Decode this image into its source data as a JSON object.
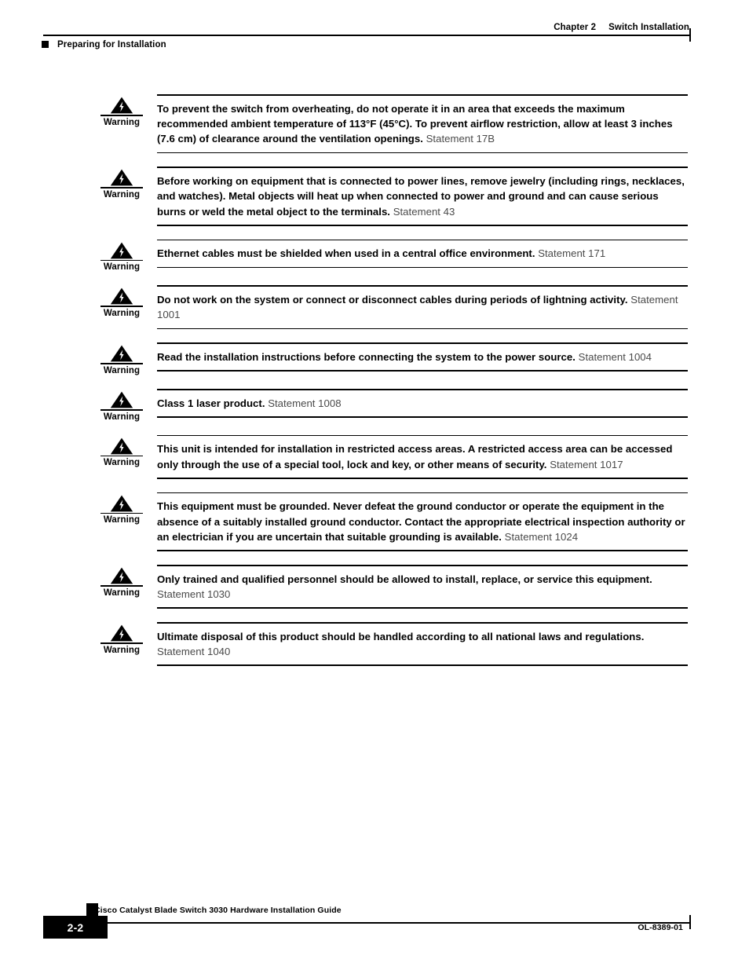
{
  "header": {
    "chapter_label": "Chapter 2",
    "chapter_title": "Switch Installation",
    "section_title": "Preparing for Installation"
  },
  "warning_label": "Warning",
  "icon_name": "warning-lightning-triangle-icon",
  "warnings": [
    {
      "text": "To prevent the switch from overheating, do not operate it in an area that exceeds the maximum recommended ambient temperature of 113°F (45°C). To prevent airflow restriction, allow at least 3 inches (7.6 cm) of clearance around the ventilation openings.",
      "statement": "Statement 17B"
    },
    {
      "text": "Before working on equipment that is connected to power lines, remove jewelry (including rings, necklaces, and watches). Metal objects will heat up when connected to power and ground and can cause serious burns or weld the metal object to the terminals.",
      "statement": "Statement 43"
    },
    {
      "text": "Ethernet cables must be shielded when used in a central office environment.",
      "statement": "Statement 171"
    },
    {
      "text": "Do not work on the system or connect or disconnect cables during periods of lightning activity.",
      "statement": "Statement 1001"
    },
    {
      "text": "Read the installation instructions before connecting the system to the power source.",
      "statement": "Statement 1004"
    },
    {
      "text": "Class 1 laser product.",
      "statement": "Statement 1008"
    },
    {
      "text": "This unit is intended for installation in restricted access areas. A restricted access area can be accessed only through the use of a special tool, lock and key, or other means of security.",
      "statement": "Statement 1017"
    },
    {
      "text": "This equipment must be grounded. Never defeat the ground conductor or operate the equipment in the absence of a suitably installed ground conductor. Contact the appropriate electrical inspection authority or an electrician if you are uncertain that suitable grounding is available.",
      "statement": "Statement 1024"
    },
    {
      "text": "Only trained and qualified personnel should be allowed to install, replace, or service this equipment.",
      "statement": "Statement 1030"
    },
    {
      "text": "Ultimate disposal of this product should be handled according to all national laws and regulations.",
      "statement": "Statement 1040"
    }
  ],
  "footer": {
    "page_number": "2-2",
    "guide_title": "Cisco Catalyst Blade Switch 3030 Hardware Installation Guide",
    "doc_id": "OL-8389-01"
  }
}
